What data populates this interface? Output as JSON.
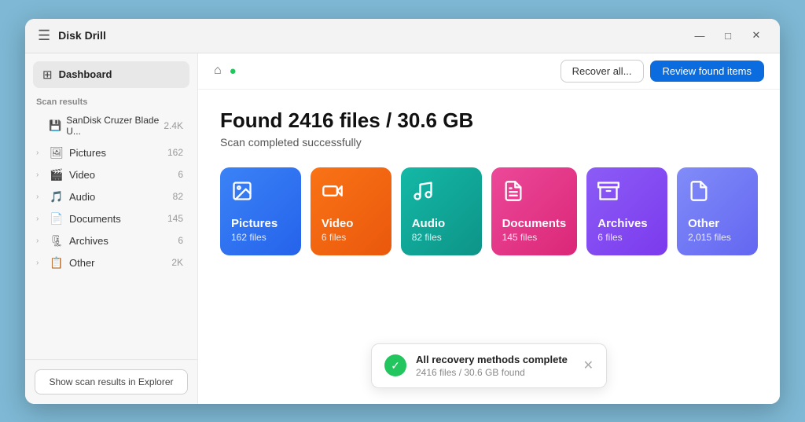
{
  "titlebar": {
    "app_name": "Disk Drill",
    "recover_all_label": "Recover all...",
    "review_btn_label": "Review found items"
  },
  "sidebar": {
    "dashboard_label": "Dashboard",
    "scan_results_label": "Scan results",
    "drive": {
      "label": "SanDisk Cruzer Blade U...",
      "count": "2.4K"
    },
    "items": [
      {
        "label": "Pictures",
        "count": "162",
        "icon": "🖼"
      },
      {
        "label": "Video",
        "count": "6",
        "icon": "🎬"
      },
      {
        "label": "Audio",
        "count": "82",
        "icon": "🎵"
      },
      {
        "label": "Documents",
        "count": "145",
        "icon": "📄"
      },
      {
        "label": "Archives",
        "count": "6",
        "icon": "🗜"
      },
      {
        "label": "Other",
        "count": "2K",
        "icon": "📋"
      }
    ],
    "show_explorer_btn": "Show scan results in Explorer"
  },
  "main": {
    "found_title": "Found 2416 files / 30.6 GB",
    "scan_status": "Scan completed successfully",
    "cards": [
      {
        "label": "Pictures",
        "count": "162 files",
        "class": "card-pictures",
        "icon": "🖼"
      },
      {
        "label": "Video",
        "count": "6 files",
        "class": "card-video",
        "icon": "🎬"
      },
      {
        "label": "Audio",
        "count": "82 files",
        "class": "card-audio",
        "icon": "🎵"
      },
      {
        "label": "Documents",
        "count": "145 files",
        "class": "card-documents",
        "icon": "📄"
      },
      {
        "label": "Archives",
        "count": "6 files",
        "class": "card-archives",
        "icon": "🗜"
      },
      {
        "label": "Other",
        "count": "2,015 files",
        "class": "card-other",
        "icon": "📋"
      }
    ]
  },
  "toast": {
    "title": "All recovery methods complete",
    "subtitle": "2416 files / 30.6 GB found"
  },
  "icons": {
    "hamburger": "☰",
    "home": "⌂",
    "check_circle": "✔",
    "minimize": "—",
    "maximize": "□",
    "close": "✕",
    "chevron_right": "›",
    "grid": "⊞",
    "drive": "💾",
    "toast_check": "✓",
    "close_toast": "✕"
  }
}
